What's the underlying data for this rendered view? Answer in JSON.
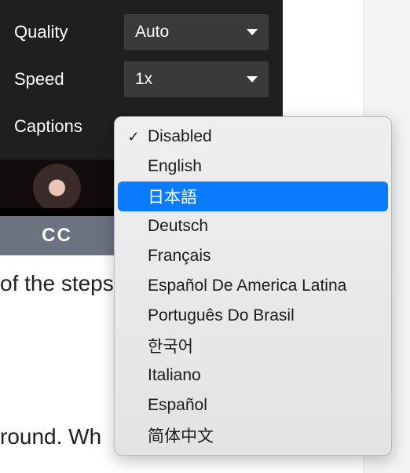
{
  "settings_panel": {
    "rows": [
      {
        "label": "Quality",
        "value": "Auto"
      },
      {
        "label": "Speed",
        "value": "1x"
      },
      {
        "label": "Captions",
        "value": ""
      }
    ]
  },
  "captions_menu": {
    "items": [
      {
        "label": "Disabled",
        "checked": true,
        "highlighted": false
      },
      {
        "label": "English",
        "checked": false,
        "highlighted": false
      },
      {
        "label": "日本語",
        "checked": false,
        "highlighted": true
      },
      {
        "label": "Deutsch",
        "checked": false,
        "highlighted": false
      },
      {
        "label": "Français",
        "checked": false,
        "highlighted": false
      },
      {
        "label": "Español De America Latina",
        "checked": false,
        "highlighted": false
      },
      {
        "label": "Português Do Brasil",
        "checked": false,
        "highlighted": false
      },
      {
        "label": "한국어",
        "checked": false,
        "highlighted": false
      },
      {
        "label": "Italiano",
        "checked": false,
        "highlighted": false
      },
      {
        "label": "Español",
        "checked": false,
        "highlighted": false
      },
      {
        "label": "简体中文",
        "checked": false,
        "highlighted": false
      }
    ]
  },
  "player_controls": {
    "cc_badge": "CC"
  },
  "background_text": {
    "line1": "of the steps",
    "line2": "round. Wh"
  },
  "colors": {
    "panel_bg": "#1f1f1f",
    "select_bg": "#3a3a3a",
    "highlight": "#0a7aff",
    "menu_bg_top": "#efeff0",
    "menu_bg_bottom": "#e3e3e5"
  }
}
